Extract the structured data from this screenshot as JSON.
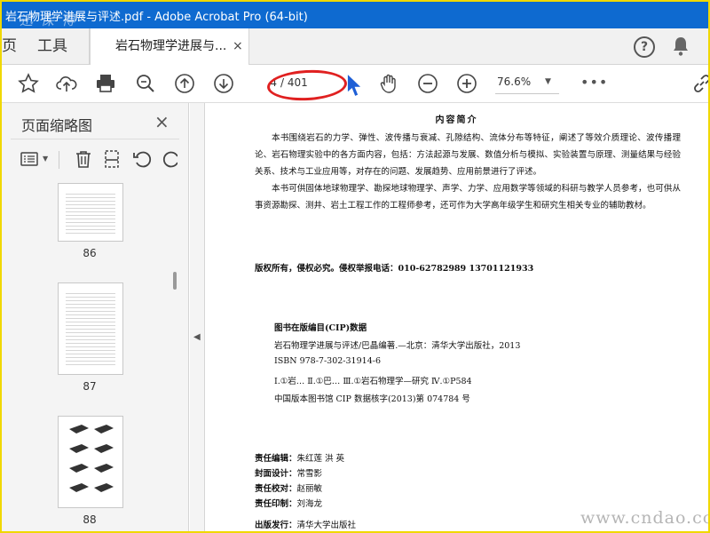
{
  "window": {
    "title": "岩石物理学进展与评述.pdf - Adobe Acrobat Pro (64-bit)",
    "overlay_watermark_top": "迅 保 得"
  },
  "tabs": {
    "home_edge": "页",
    "tools": "工具",
    "doc": "岩石物理学进展与...",
    "close": "×"
  },
  "toolbar": {
    "page_current": "4",
    "page_total": "/ 401",
    "zoom": "76.6%",
    "zoom_caret": "▼",
    "more": "•••",
    "help": "?"
  },
  "side_panel": {
    "title": "页面缩略图",
    "close": "×",
    "thumbnails": [
      {
        "label": "86"
      },
      {
        "label": "87"
      },
      {
        "label": "88"
      }
    ]
  },
  "document": {
    "heading": "内容简介",
    "para1": "本书围绕岩石的力学、弹性、波传播与衰减、孔隙结构、流体分布等特征，阐述了等效介质理论、波传播理论、岩石物理实验中的各方面内容，包括：方法起源与发展、数值分析与模拟、实验装置与原理、测量结果与经验关系、技术与工业应用等，对存在的问题、发展趋势、应用前景进行了评述。",
    "para2": "本书可供固体地球物理学、勘探地球物理学、声学、力学、应用数学等领域的科研与教学人员参考，也可供从事资源勘探、测井、岩土工程工作的工程师参考，还可作为大学高年级学生和研究生相关专业的辅助教材。",
    "copyright": "版权所有，侵权必究。侵权举报电话：010-62782989    13701121933",
    "cip_title": "图书在版编目(CIP)数据",
    "cip_lines": [
      "岩石物理学进展与评述/巴晶编著.—北京：清华大学出版社，2013",
      "ISBN 978-7-302-31914-6",
      "Ⅰ.①岩…   Ⅱ.①巴…   Ⅲ.①岩石物理学—研究   Ⅳ.①P584",
      "中国版本图书馆 CIP 数据核字(2013)第 074784 号"
    ],
    "credits": [
      {
        "role": "责任编辑：",
        "name": "朱红莲   洪   英"
      },
      {
        "role": "封面设计：",
        "name": "常雪影"
      },
      {
        "role": "责任校对：",
        "name": "赵丽敏"
      },
      {
        "role": "责任印制：",
        "name": "刘海龙"
      },
      {
        "role": "出版发行：",
        "name": "清华大学出版社"
      }
    ]
  },
  "overlay_watermark_bottom": "www.cndao.com",
  "colors": {
    "title_bar": "#0e6ad0",
    "highlight_ellipse": "#e02020",
    "cursor": "#1e5fd6"
  }
}
